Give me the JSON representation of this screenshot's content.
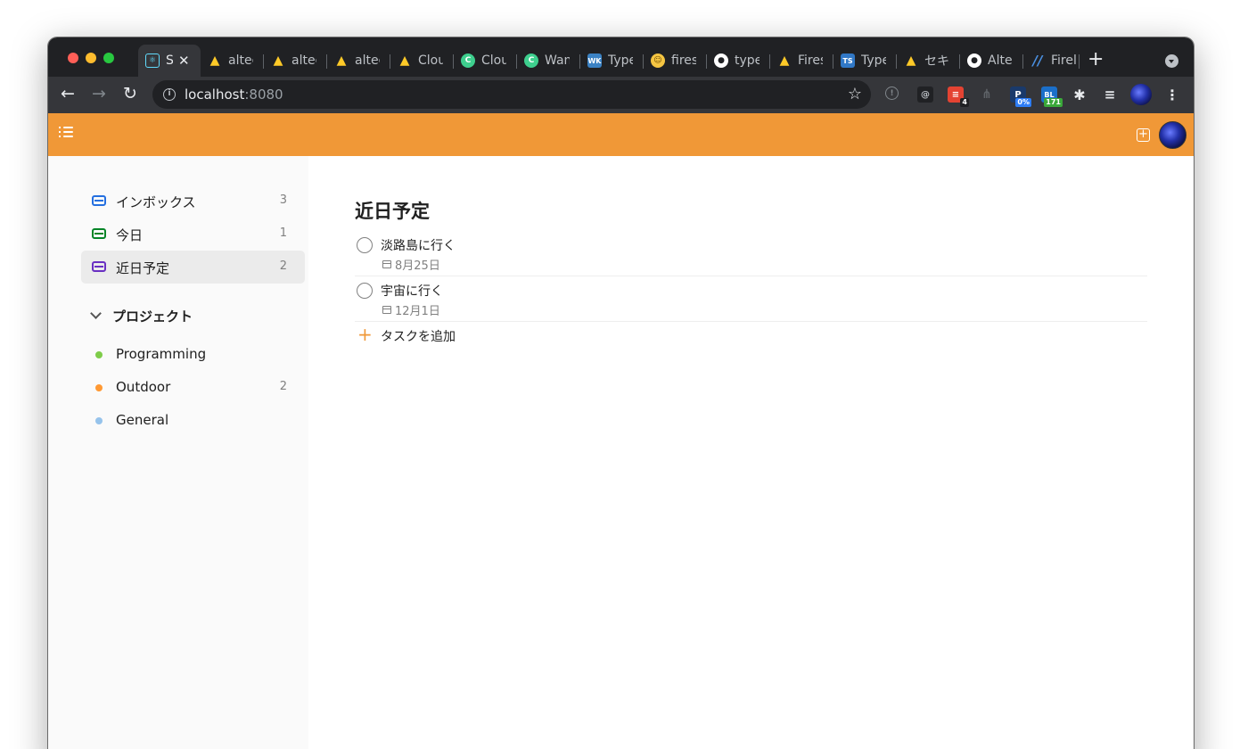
{
  "browser": {
    "tabs": [
      {
        "label": "S",
        "icon": "react-icon",
        "color": "#61dafb",
        "active": true
      },
      {
        "label": "altec",
        "icon": "firebase-icon",
        "color": "#ffca28"
      },
      {
        "label": "altec",
        "icon": "firebase-icon",
        "color": "#ffca28"
      },
      {
        "label": "altec",
        "icon": "firebase-icon",
        "color": "#ffca28"
      },
      {
        "label": "Clou",
        "icon": "firebase-icon",
        "color": "#ffca28"
      },
      {
        "label": "Clou",
        "icon": "cloud-green-icon",
        "color": "#3ecf8e"
      },
      {
        "label": "Wan",
        "icon": "cloud-green-icon",
        "color": "#3ecf8e"
      },
      {
        "label": "Type",
        "icon": "wk-icon",
        "color": "#3b82c4"
      },
      {
        "label": "fires",
        "icon": "face-icon",
        "color": "#f5c542"
      },
      {
        "label": "type",
        "icon": "github-icon",
        "color": "#ffffff"
      },
      {
        "label": "Fires",
        "icon": "firebase-icon",
        "color": "#ffca28"
      },
      {
        "label": "Type",
        "icon": "ts-icon",
        "color": "#3178c6"
      },
      {
        "label": "セキ",
        "icon": "firebase-icon",
        "color": "#ffca28"
      },
      {
        "label": "Alte",
        "icon": "github-icon",
        "color": "#ffffff"
      },
      {
        "label": "Firel",
        "icon": "slash-icon",
        "color": "#4a90e2"
      }
    ],
    "url_host": "localhost",
    "url_port": ":8080",
    "extensions": [
      {
        "icon": "info-ext-icon",
        "badge": ""
      },
      {
        "icon": "at-ext-icon",
        "badge": ""
      },
      {
        "icon": "todoist-ext-icon",
        "badge": "4"
      },
      {
        "icon": "share-ext-icon",
        "badge": ""
      },
      {
        "icon": "p-ext-icon",
        "badge": "0%"
      },
      {
        "icon": "bl-ext-icon",
        "badge": "171"
      }
    ]
  },
  "sidebar": {
    "filters": [
      {
        "label": "インボックス",
        "count": "3",
        "color": "#246fe0"
      },
      {
        "label": "今日",
        "count": "1",
        "color": "#058527"
      },
      {
        "label": "近日予定",
        "count": "2",
        "color": "#692fc2"
      }
    ],
    "projects_header": "プロジェクト",
    "projects": [
      {
        "label": "Programming",
        "count": "",
        "color": "#7ecc49"
      },
      {
        "label": "Outdoor",
        "count": "2",
        "color": "#ff9933"
      },
      {
        "label": "General",
        "count": "",
        "color": "#96c3eb"
      }
    ]
  },
  "main": {
    "title": "近日予定",
    "tasks": [
      {
        "title": "淡路島に行く",
        "date": "8月25日"
      },
      {
        "title": "宇宙に行く",
        "date": "12月1日"
      }
    ],
    "add_task_label": "タスクを追加"
  }
}
